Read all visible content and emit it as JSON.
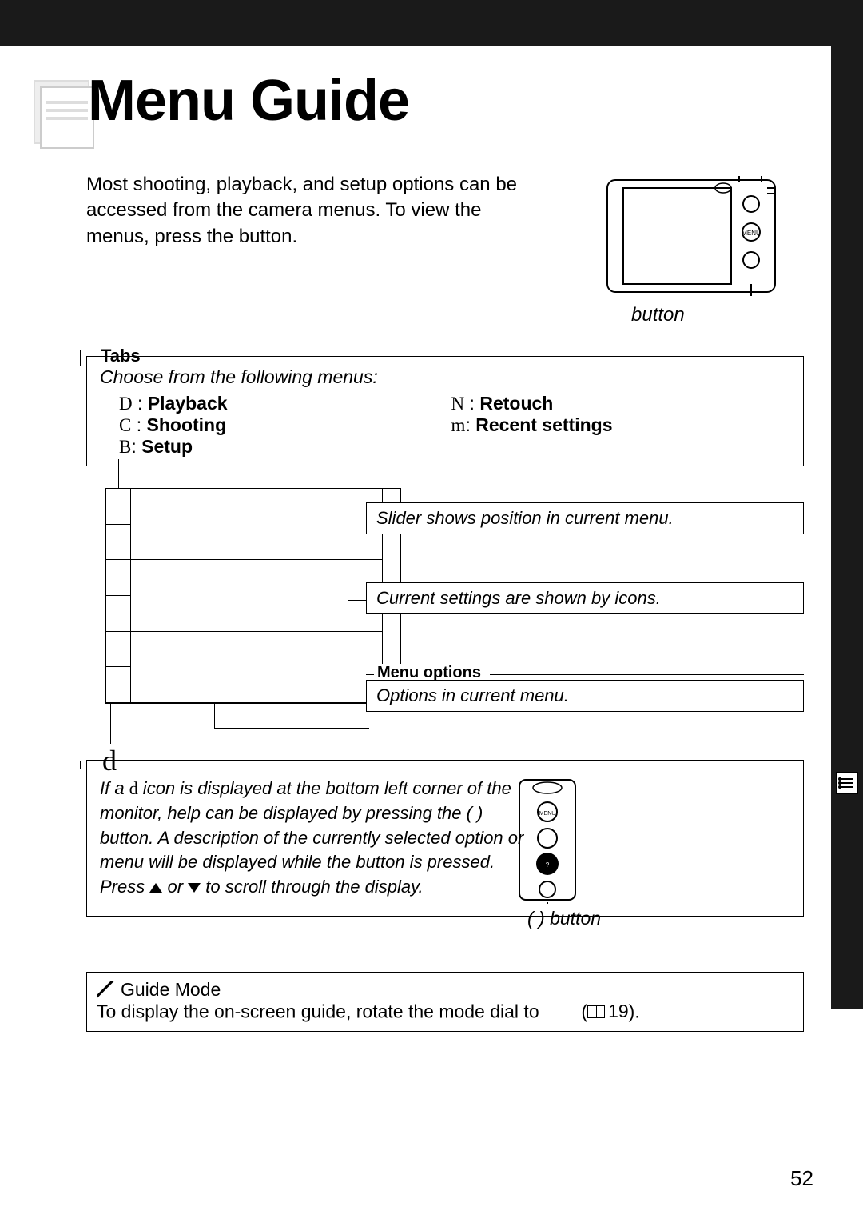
{
  "title": "Menu Guide",
  "intro": "Most shooting, playback, and setup options can be accessed from the camera menus.  To view the menus, press the          button.",
  "camera1_caption": "button",
  "tabs": {
    "label": "Tabs",
    "subtitle": "Choose from the following menus:",
    "left": [
      {
        "sym": "D",
        "name": "Playback"
      },
      {
        "sym": "C",
        "name": "Shooting"
      },
      {
        "sym": "B",
        "name": "Setup"
      }
    ],
    "right": [
      {
        "sym": "N",
        "name": "Retouch"
      },
      {
        "sym": "m",
        "name": "Recent settings"
      }
    ]
  },
  "callouts": {
    "slider": "Slider shows position in current menu.",
    "settings": "Current settings are shown by icons.",
    "menu_options_label": "Menu options",
    "menu_options_text": "Options in current menu."
  },
  "d_section": {
    "symbol": "d",
    "text_parts": {
      "p1": "If a ",
      "sym": "d",
      "p2": " icon is displayed at the bottom left corner of the monitor, help can be displayed by pressing the        (  ) button.  A description of the currently selected option or menu will be displayed while the button is pressed.  Press ",
      "or": " or ",
      "p3": " to scroll through the display."
    },
    "button_caption": "(  ) button"
  },
  "guide_mode": {
    "title": "Guide Mode",
    "text_a": "To display the on-screen guide, rotate the mode dial to ",
    "text_b": " (",
    "pageref": "19",
    "text_c": ")."
  },
  "page_number": "52"
}
